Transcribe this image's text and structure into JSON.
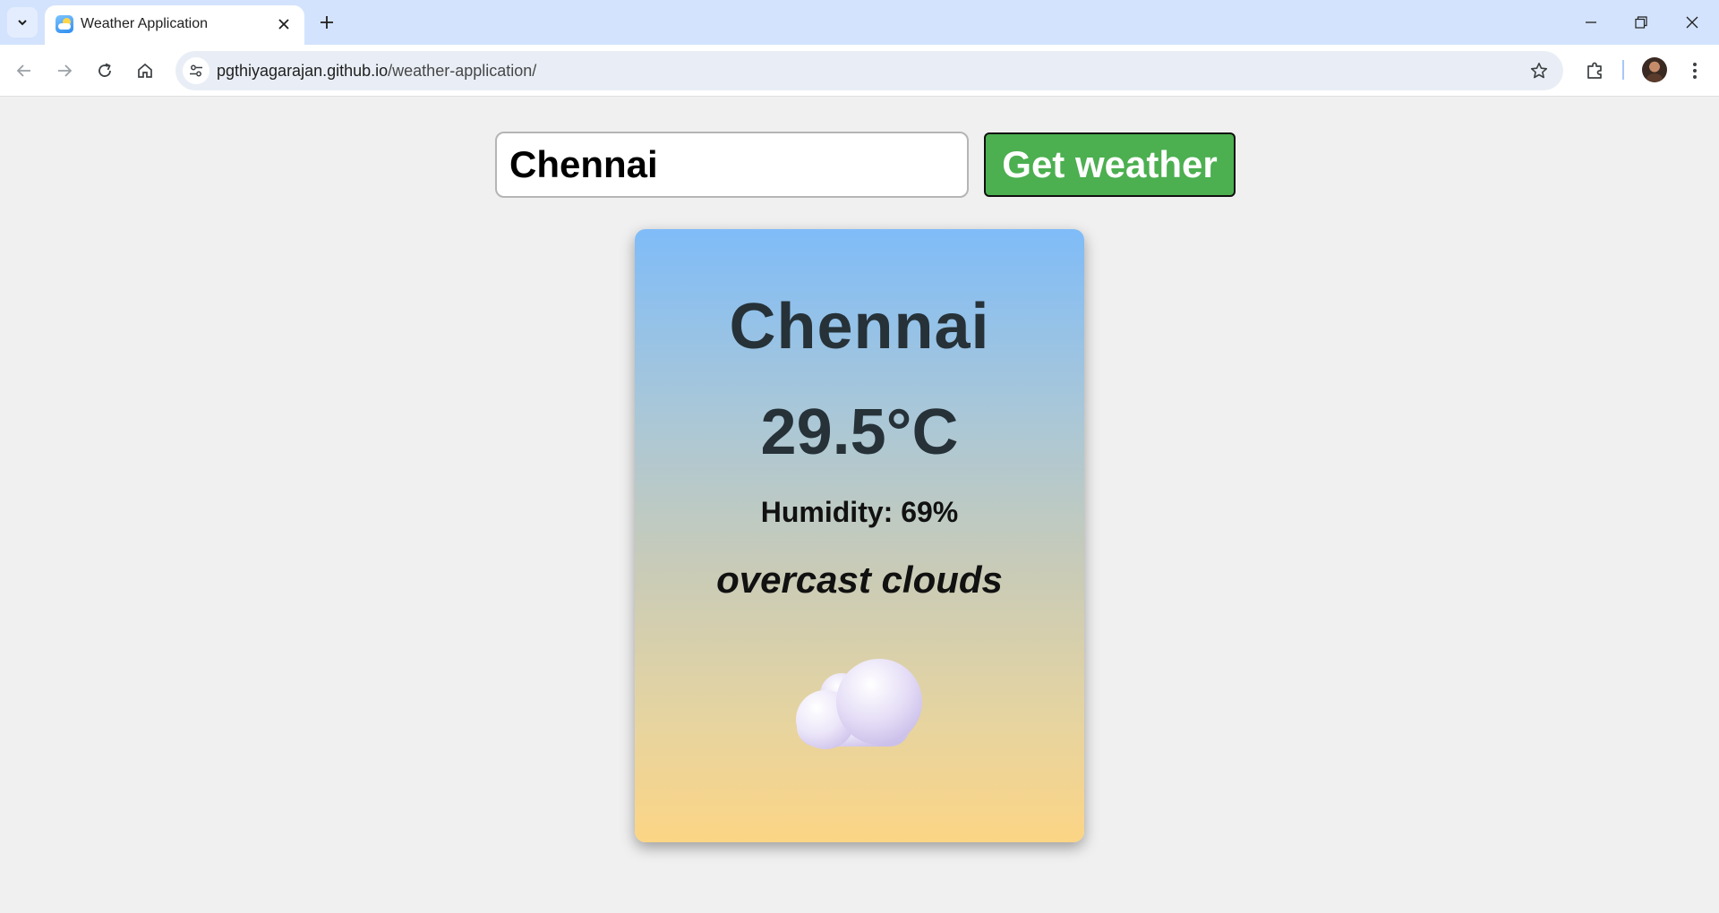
{
  "browser": {
    "tab_title": "Weather Application",
    "url_host": "pgthiyagarajan.github.io",
    "url_path": "/weather-application/"
  },
  "search": {
    "value": "Chennai",
    "button_label": "Get weather"
  },
  "weather": {
    "city": "Chennai",
    "temperature": "29.5°C",
    "humidity": "Humidity: 69%",
    "description": "overcast clouds",
    "icon": "cloud-icon"
  },
  "colors": {
    "button": "#4caf50",
    "card_top": "#7fbcf8",
    "card_bottom": "#fcd585"
  }
}
